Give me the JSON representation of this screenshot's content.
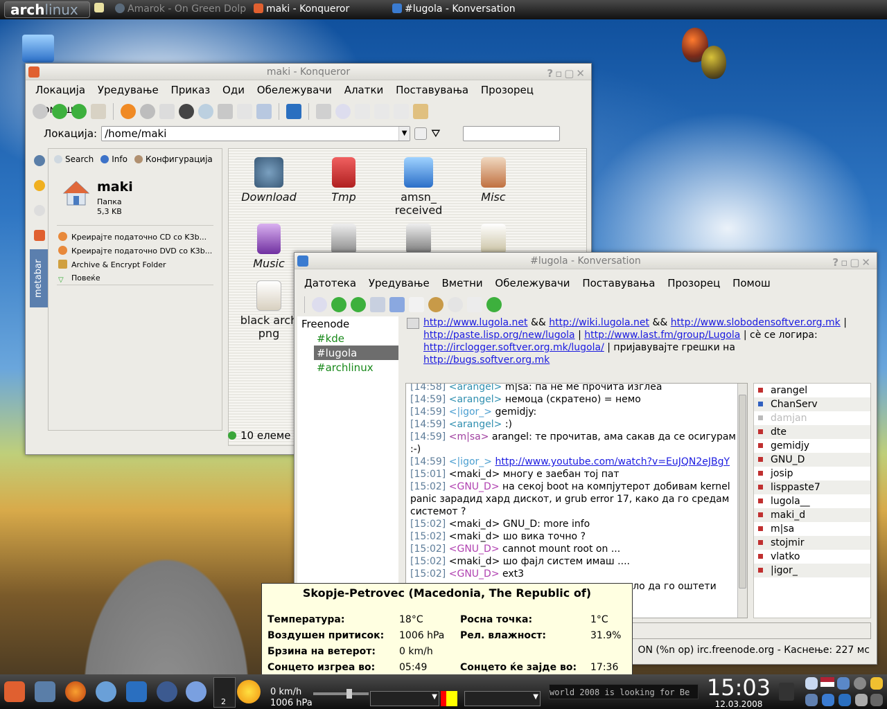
{
  "topbar": {
    "logo_arch": "arch",
    "logo_linux": "linux",
    "tasks": [
      "Amarok - On Green Dolp",
      "maki - Konqueror",
      "#lugola - Konversation"
    ]
  },
  "konqueror": {
    "title": "maki - Konqueror",
    "menu": [
      "Локација",
      "Уредување",
      "Приказ",
      "Оди",
      "Обележувачи",
      "Алатки",
      "Поставувања",
      "Прозорец",
      "Помош"
    ],
    "location_label": "Локација:",
    "location_value": "/home/maki",
    "sidebar_tab": "metabar",
    "meta": {
      "tabs": [
        "Search",
        "Info",
        "Конфигурација"
      ],
      "folder_name": "maki",
      "folder_type": "Папка",
      "folder_size": "5,3 KB",
      "actions": [
        "Креирајте податочно CD со K3b...",
        "Креирајте податочно DVD со K3b...",
        "Archive & Encrypt Folder",
        "Повеќе"
      ]
    },
    "files": [
      "Download",
      "Tmp",
      "amsn_ received",
      "Misc",
      "Music",
      "",
      "",
      "",
      "black arch png"
    ],
    "status": "10 елеме"
  },
  "konversation": {
    "title": "#lugola - Konversation",
    "menu": [
      "Датотека",
      "Уредување",
      "Вметни",
      "Обележувачи",
      "Поставувања",
      "Прозорец",
      "Помош"
    ],
    "tree": {
      "network": "Freenode",
      "channels": [
        "#kde",
        "#lugola",
        "#archlinux"
      ]
    },
    "topic": {
      "l1a": "http://www.lugola.net",
      "l1b": " && ",
      "l1c": "http://wiki.lugola.net",
      "l1d": " && ",
      "l1e": "http://www.slobodensoftver.org.mk",
      "l1f": " |",
      "l2a": "http://paste.lisp.org/new/lugola",
      "l2b": " | ",
      "l2c": "http://www.last.fm/group/Lugola",
      "l2d": " | сè се логира:",
      "l3a": "http://irclogger.softver.org.mk/lugola/",
      "l3b": " | пријавувајте грешки на",
      "l4a": "http://bugs.softver.org.mk"
    },
    "messages": [
      {
        "ts": "[14:58]",
        "nick": "<arangel>",
        "text": "m|sa: па не ме прочита изглеа",
        "color": "#2f8fb0"
      },
      {
        "ts": "[14:59]",
        "nick": "<arangel>",
        "text": "немоца (скратено) = немо",
        "color": "#2f8fb0"
      },
      {
        "ts": "[14:59]",
        "nick": "<|igor_>",
        "text": "gemidjy:",
        "color": "#4a9ed0"
      },
      {
        "ts": "[14:59]",
        "nick": "<arangel>",
        "text": ":)",
        "color": "#2f8fb0"
      },
      {
        "ts": "[14:59]",
        "nick": "<m|sa>",
        "text": "arangel: те прочитав, ама сакав да се осигурам :-)",
        "color": "#a040a0"
      },
      {
        "ts": "[14:59]",
        "nick": "<|igor_>",
        "text": "http://www.youtube.com/watch?v=EuJQN2eJBgY",
        "color": "#4a9ed0",
        "link": true
      },
      {
        "ts": "[15:01]",
        "nick": "<maki_d>",
        "text": "многу е заебан тој пат",
        "color": "#000000"
      },
      {
        "ts": "[15:02]",
        "nick": "<GNU_D>",
        "text": "на секој boot на компјутерот добивам kernel panic зарадид хард дискот, и grub error 17, како да го средам системот ?",
        "color": "#b040b0"
      },
      {
        "ts": "[15:02]",
        "nick": "<maki_d>",
        "text": "GNU_D: more info",
        "color": "#000000"
      },
      {
        "ts": "[15:02]",
        "nick": "<maki_d>",
        "text": "шо вика точно ?",
        "color": "#000000"
      },
      {
        "ts": "[15:02]",
        "nick": "<GNU_D>",
        "text": "cannot mount root on ...",
        "color": "#b040b0"
      },
      {
        "ts": "[15:02]",
        "nick": "<maki_d>",
        "text": "шо фајл систем имаш ....",
        "color": "#000000"
      },
      {
        "ts": "[15:02]",
        "nick": "<GNU_D>",
        "text": "ext3",
        "color": "#b040b0"
      },
      {
        "ts": "",
        "nick": "",
        "text": "жело да го оштети",
        "color": "#000000"
      }
    ],
    "nicks": [
      {
        "n": "arangel",
        "c": "#c03030"
      },
      {
        "n": "ChanServ",
        "c": "#3060c0"
      },
      {
        "n": "damjan",
        "c": "#bbbbbb",
        "dim": true
      },
      {
        "n": "dte",
        "c": "#c03030"
      },
      {
        "n": "gemidjy",
        "c": "#c03030"
      },
      {
        "n": "GNU_D",
        "c": "#c03030"
      },
      {
        "n": "josip",
        "c": "#c03030"
      },
      {
        "n": "lisppaste7",
        "c": "#c03030"
      },
      {
        "n": "lugola__",
        "c": "#c03030"
      },
      {
        "n": "maki_d",
        "c": "#c03030"
      },
      {
        "n": "m|sa",
        "c": "#c03030"
      },
      {
        "n": "stojmir",
        "c": "#c03030"
      },
      {
        "n": "vlatko",
        "c": "#c03030"
      },
      {
        "n": "|igor_",
        "c": "#c03030"
      }
    ],
    "status": "ON (%n op) irc.freenode.org - Каснење: 227 мс"
  },
  "weather": {
    "station": "Skopje-Petrovec (Macedonia, The Republic of)",
    "temp_label": "Температура:",
    "temp": "18°C",
    "dew_label": "Росна точка:",
    "dew": "1°C",
    "pressure_label": "Воздушен притисок:",
    "pressure": "1006 hPa",
    "humidity_label": "Рел. влажност:",
    "humidity": "31.9%",
    "wind_label": "Брзина на ветерот:",
    "wind": "0 km/h",
    "sunrise_label": "Сонцето изгреа во:",
    "sunrise": "05:49",
    "sunset_label": "Сонцето ќе зајде во:",
    "sunset": "17:36"
  },
  "panel": {
    "desktop": "2",
    "wx_wind": "0 km/h",
    "wx_pressure": "1006 hPa",
    "marquee": "world 2008 is looking for Be",
    "clock": "15:03",
    "date": "12.03.2008"
  }
}
